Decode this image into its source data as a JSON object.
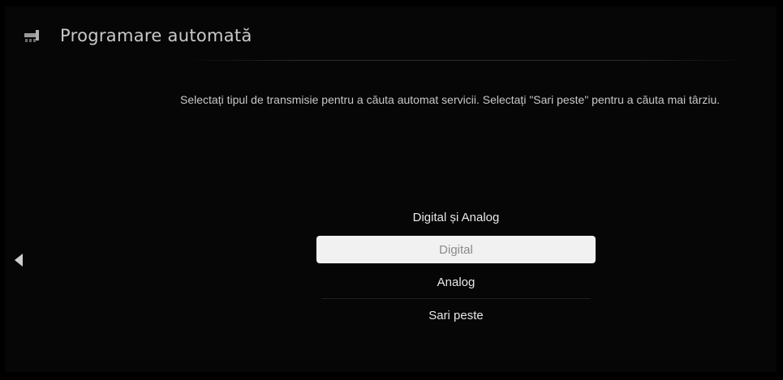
{
  "header": {
    "title": "Programare automată",
    "icon": "wrench-icon"
  },
  "description": "Selectați tipul de transmisie pentru a căuta automat servicii. Selectați \"Sari peste\" pentru a căuta mai târziu.",
  "options": [
    {
      "label": "Digital și Analog"
    },
    {
      "label": "Digital",
      "selected": true
    },
    {
      "label": "Analog"
    },
    {
      "label": "Sari peste"
    }
  ],
  "nav": {
    "back_icon": "left-arrow-icon"
  },
  "colors": {
    "background": "#060606",
    "highlight": "#f1f1f1",
    "text": "#e8e8e8"
  }
}
